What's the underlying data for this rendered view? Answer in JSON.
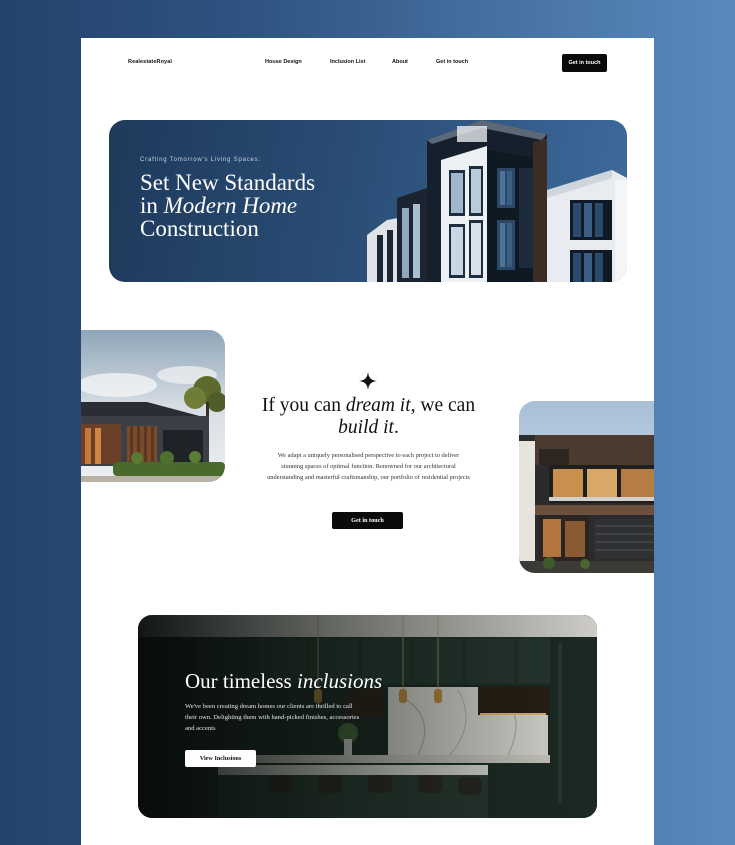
{
  "nav": {
    "brand": "RealestateRoyal",
    "links": [
      "House Design",
      "Inclusion List",
      "About",
      "Get in touch"
    ],
    "cta": "Get in touch"
  },
  "hero": {
    "tagline": "Crafting Tomorrow's Living Spaces:",
    "title_line1": "Set New Standards",
    "title_line2_prefix": "in ",
    "title_line2_italic": "Modern Home",
    "title_line3": "Construction"
  },
  "about": {
    "title_part1": "If you can ",
    "title_italic1": "dream it",
    "title_part2": ", we can ",
    "title_italic2": "build it",
    "title_part3": ".",
    "body": "We adapt a uniquely personalised perspective to each project to deliver stunning spaces of optimal function. Renowned for our architectural understanding and masterful craftsmanship, our portfolio of residential projects",
    "cta": "Get in touch"
  },
  "inclusions": {
    "title_plain": "Our timeless ",
    "title_italic": "inclusions",
    "body": "We've been creating dream homes our clients are thrilled to call their own. Delighting them with hand-picked finishes, accessories and accents",
    "cta": "View Inclusions"
  },
  "colors": {
    "hero_blue": "#2a4c74",
    "background_blue": "#3d6898",
    "button_black": "#0b0b0b",
    "kitchen_green": "#22312a"
  },
  "icons": [
    "sparkle-icon"
  ]
}
